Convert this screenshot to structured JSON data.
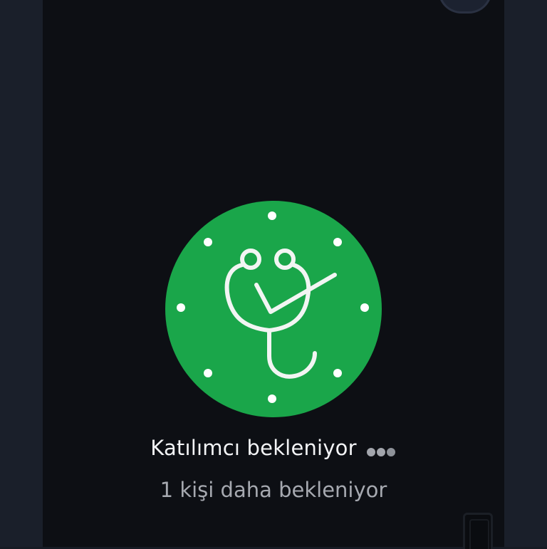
{
  "status": {
    "title": "Katılımcı bekleniyor",
    "subtitle": "1 kişi daha bekleniyor"
  },
  "icons": {
    "avatar": "stethoscope-clock-icon",
    "typing": "typing-dots-icon",
    "top_control": "round-button-icon"
  },
  "colors": {
    "background": "#0d0f14",
    "avatar_bg": "#1aa64a",
    "title_text": "#f3f4f6",
    "subtitle_text": "#a6a9b0"
  }
}
